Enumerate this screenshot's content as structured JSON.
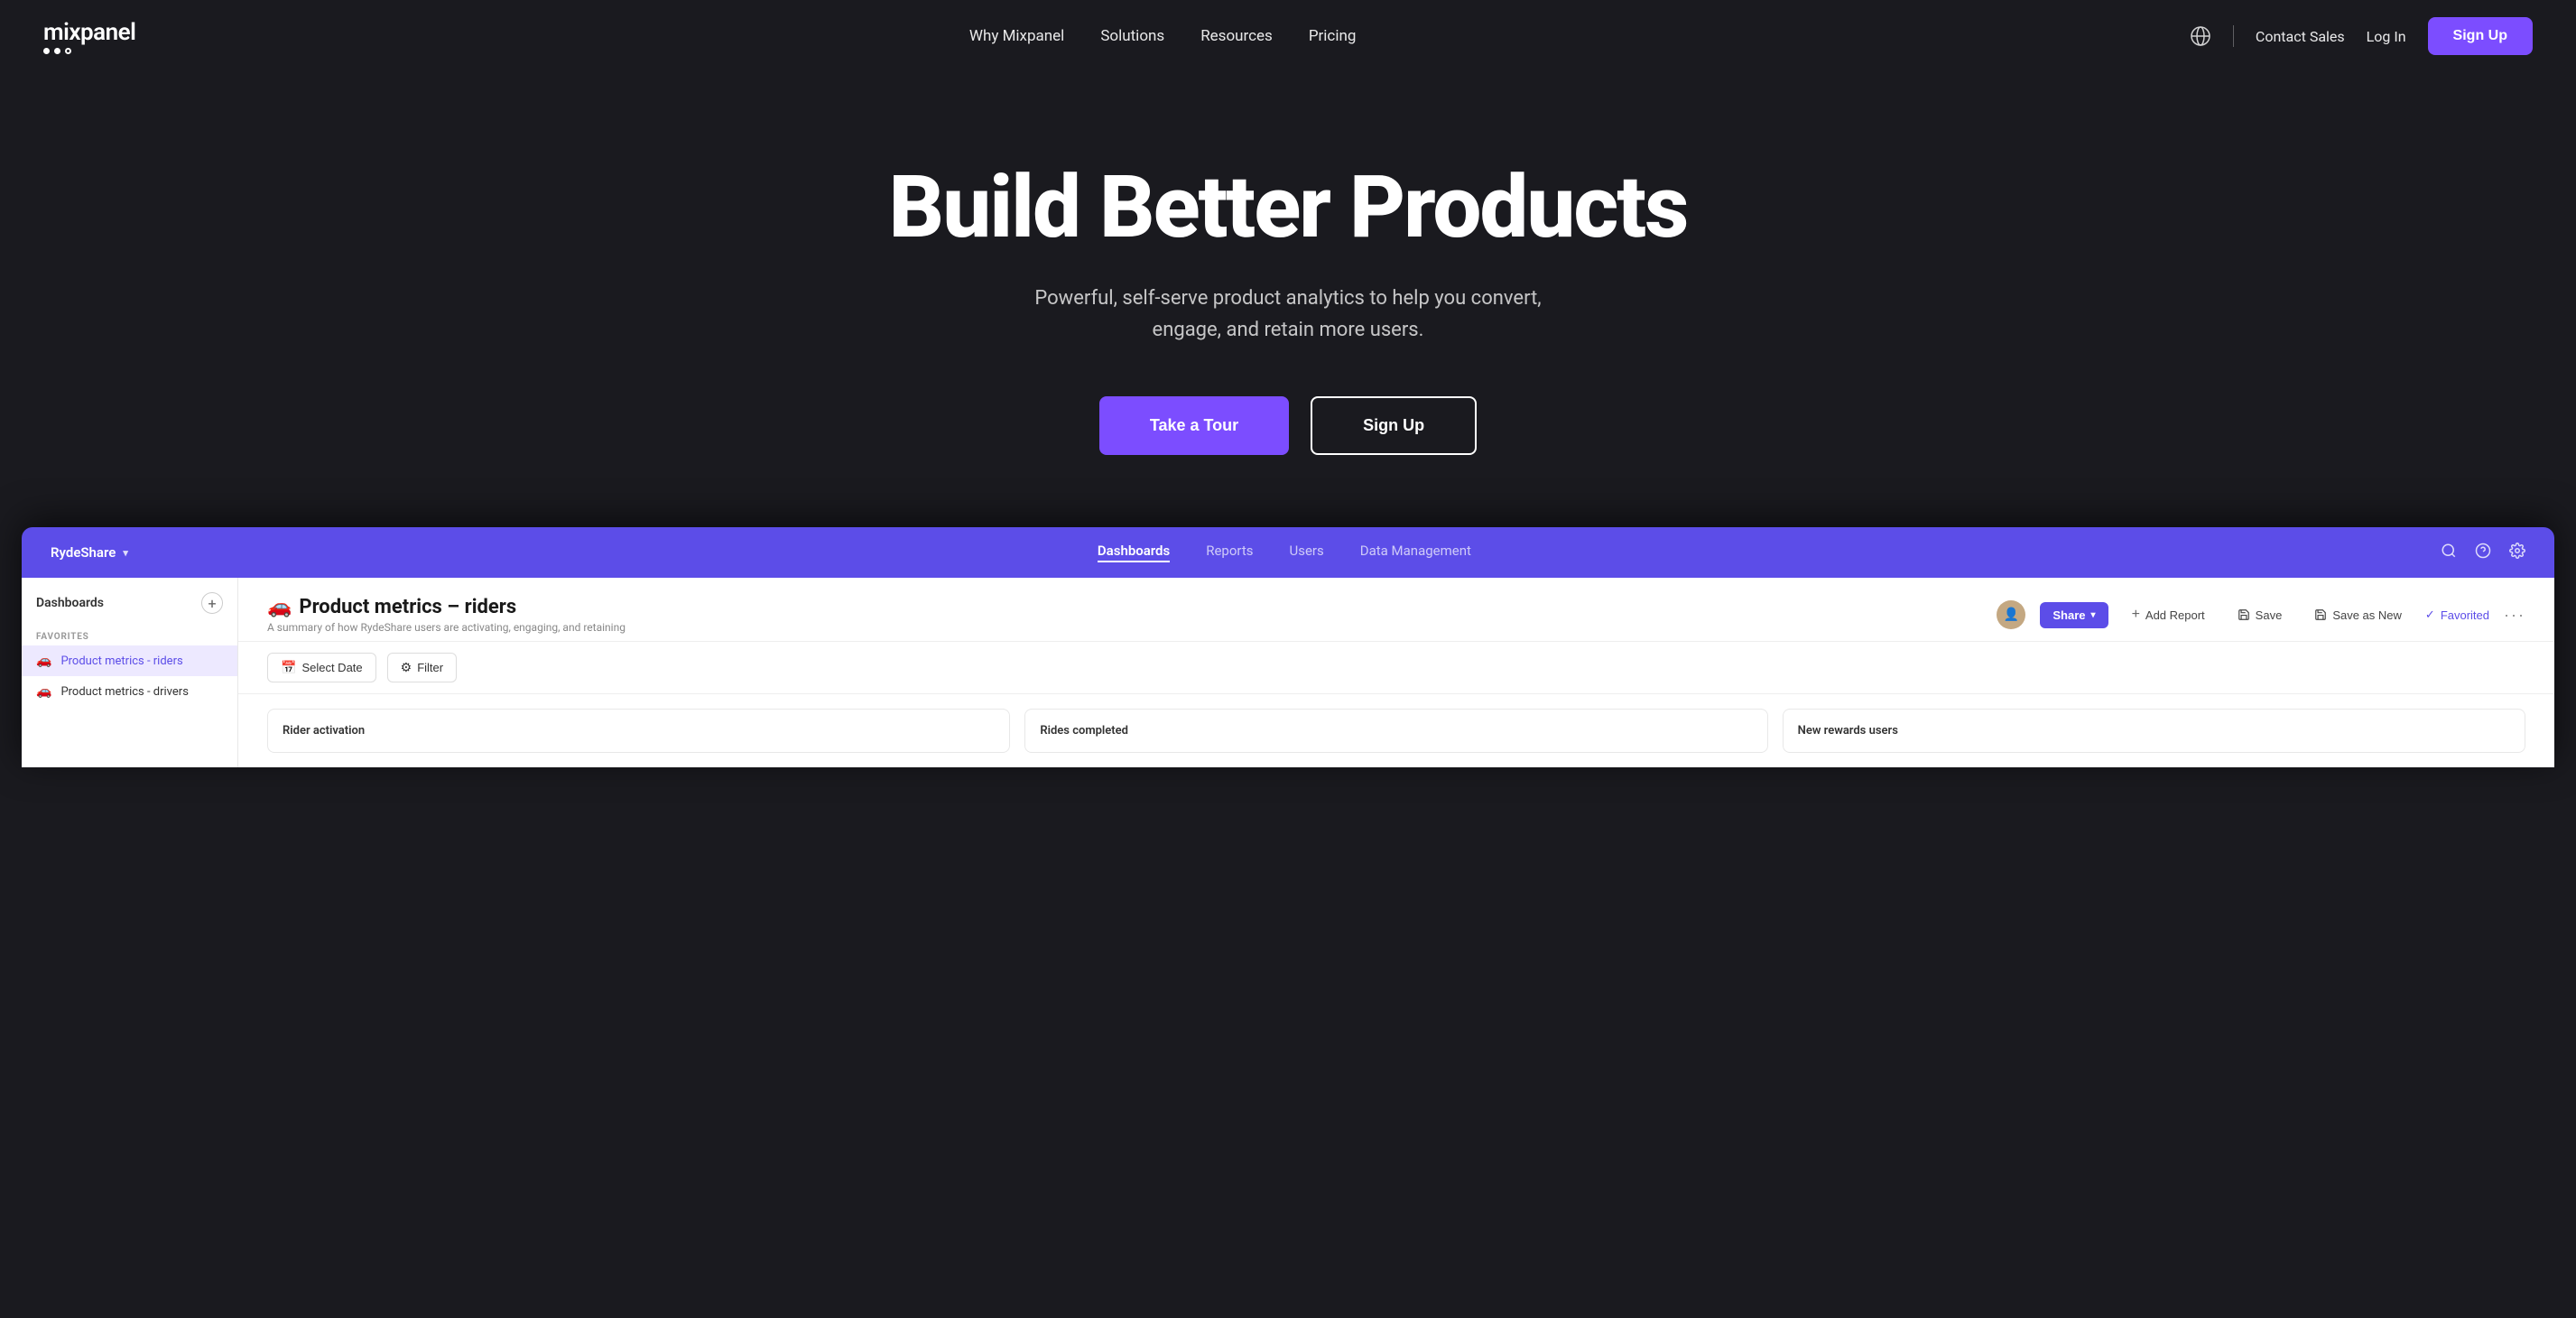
{
  "nav": {
    "logo": "mixpanel",
    "links": [
      "Why Mixpanel",
      "Solutions",
      "Resources",
      "Pricing"
    ],
    "contact": "Contact Sales",
    "login": "Log In",
    "signup": "Sign Up"
  },
  "hero": {
    "title": "Build Better Products",
    "subtitle": "Powerful, self-serve product analytics to help you convert,\nengage, and retain more users.",
    "cta_tour": "Take a Tour",
    "cta_signup": "Sign Up"
  },
  "app": {
    "org": "RydeShare",
    "nav_items": [
      "Dashboards",
      "Reports",
      "Users",
      "Data Management"
    ],
    "active_nav": "Dashboards",
    "sidebar_title": "Dashboards",
    "sidebar_section": "FAVORITES",
    "sidebar_items": [
      {
        "emoji": "🚗",
        "label": "Product metrics - riders",
        "active": true
      },
      {
        "emoji": "🚗",
        "label": "Product metrics - drivers",
        "active": false
      }
    ],
    "dashboard_title": "Product metrics – riders",
    "dashboard_emoji": "🚗",
    "dashboard_subtitle": "A summary of how RydeShare users are activating, engaging, and retaining",
    "actions": {
      "share": "Share",
      "add_report": "+ Add Report",
      "save": "Save",
      "save_as_new": "Save as New",
      "favorited": "Favorited",
      "more": "···"
    },
    "toolbar": {
      "select_date": "Select Date",
      "filter": "Filter"
    },
    "metrics": [
      {
        "title": "Rider activation"
      },
      {
        "title": "Rides completed"
      },
      {
        "title": "New rewards users"
      }
    ]
  }
}
